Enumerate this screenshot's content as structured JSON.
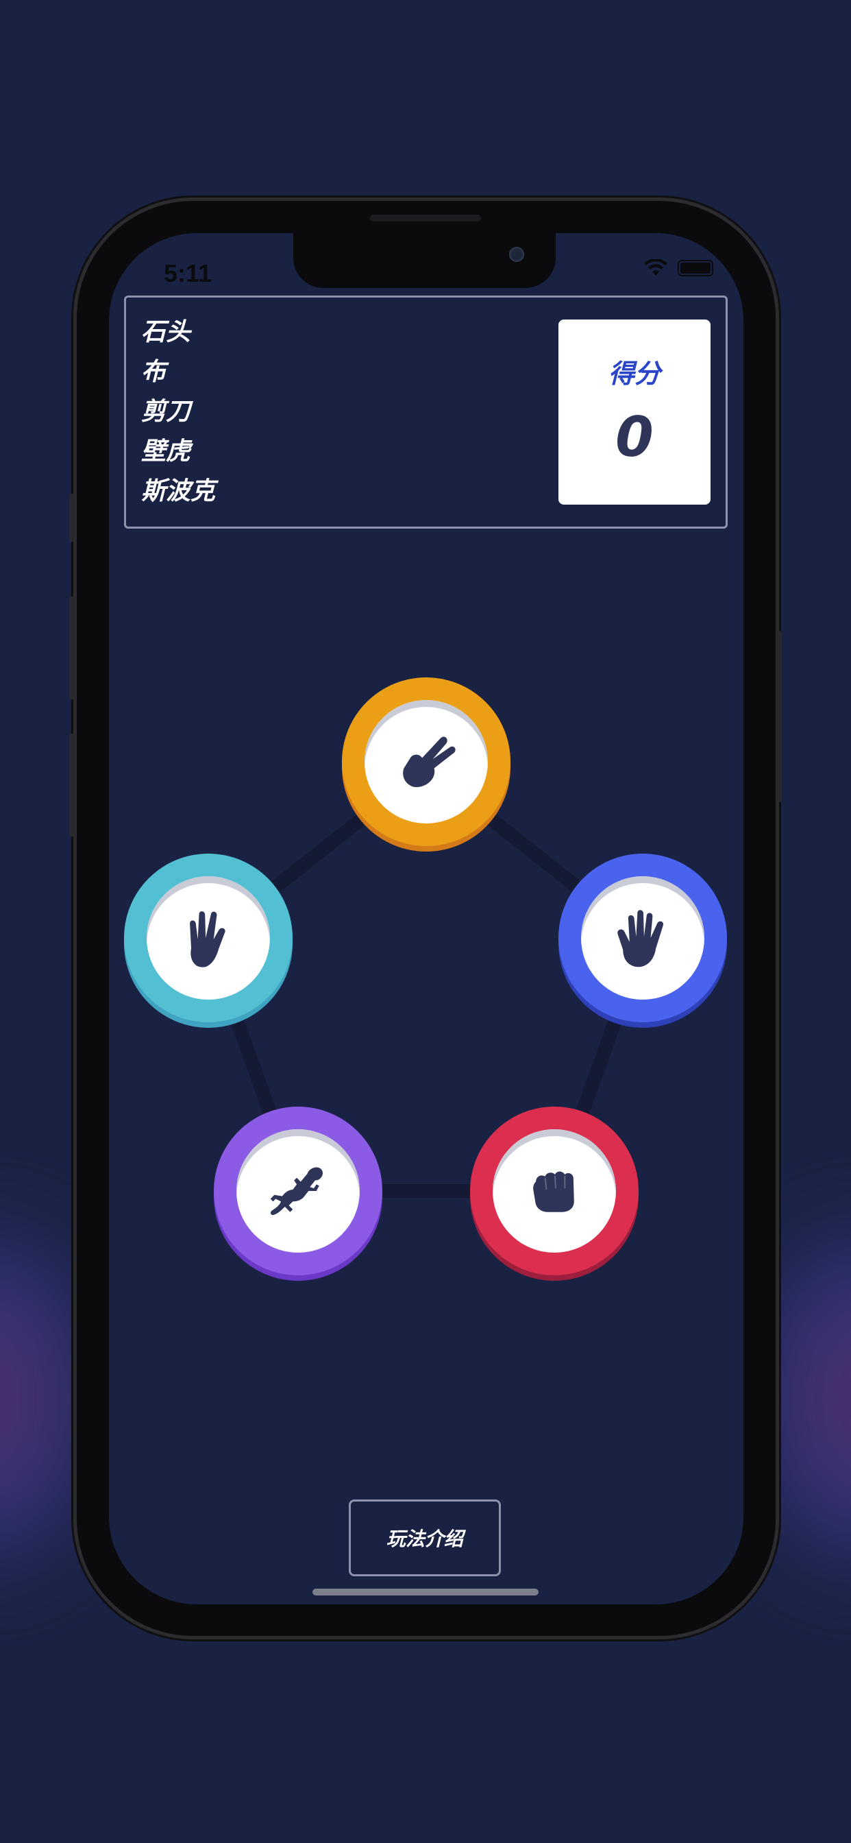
{
  "status_bar": {
    "time": "5:11"
  },
  "legend": {
    "items": [
      {
        "label": "石头"
      },
      {
        "label": "布"
      },
      {
        "label": "剪刀"
      },
      {
        "label": "壁虎"
      },
      {
        "label": "斯波克"
      }
    ]
  },
  "score": {
    "label": "得分",
    "value": "0"
  },
  "board": {
    "tokens": [
      {
        "id": "scissors",
        "icon": "scissors-hand-icon",
        "color": "#eb9f17",
        "rim": "#d57a18"
      },
      {
        "id": "paper",
        "icon": "paper-hand-icon",
        "color": "#4a63ee",
        "rim": "#2e41b8"
      },
      {
        "id": "rock",
        "icon": "rock-fist-icon",
        "color": "#dc2e4e",
        "rim": "#9e1f3d"
      },
      {
        "id": "lizard",
        "icon": "lizard-icon",
        "color": "#8c5be6",
        "rim": "#6b39c7"
      },
      {
        "id": "spock",
        "icon": "spock-hand-icon",
        "color": "#53bfd3",
        "rim": "#3fa3c1"
      }
    ]
  },
  "rules_button": {
    "label": "玩法介绍"
  },
  "colors": {
    "background": "#1a2244",
    "board_lines": "#141a33",
    "icon": "#2f3558",
    "score_label": "#2a45c8"
  }
}
